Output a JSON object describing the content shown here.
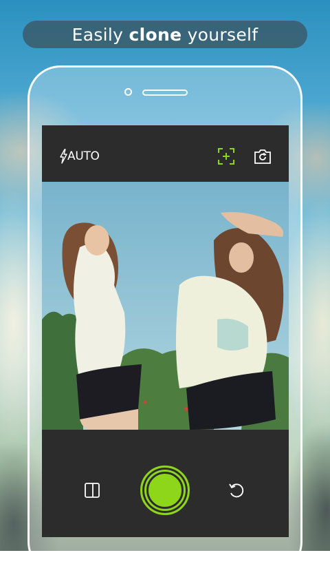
{
  "banner": {
    "prefix": "Easily ",
    "bold": "clone",
    "suffix": " yourself"
  },
  "camera": {
    "flash_icon": "lightning-icon",
    "flash_mode": "AUTO",
    "focus_icon": "focus-frame-icon",
    "switch_icon": "switch-camera-icon",
    "layout_icon": "split-layout-icon",
    "shutter_icon": "shutter-button",
    "undo_icon": "undo-icon"
  },
  "colors": {
    "accent": "#8ed61a",
    "bar": "#2c2c2c"
  }
}
